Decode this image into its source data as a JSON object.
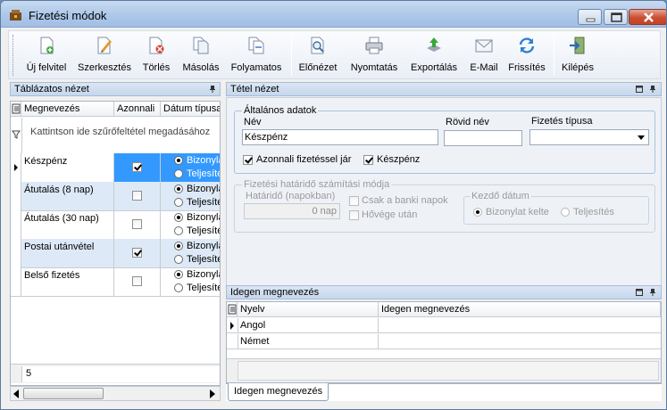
{
  "window": {
    "title": "Fizetési módok"
  },
  "toolbar": {
    "items": [
      {
        "label": "Új felvitel",
        "icon": "new-document-icon"
      },
      {
        "label": "Szerkesztés",
        "icon": "edit-icon"
      },
      {
        "label": "Törlés",
        "icon": "delete-icon"
      },
      {
        "label": "Másolás",
        "icon": "copy-icon"
      },
      {
        "label": "Folyamatos",
        "icon": "continuous-icon"
      },
      {
        "label": "Előnézet",
        "icon": "preview-icon"
      },
      {
        "label": "Nyomtatás",
        "icon": "printer-icon"
      },
      {
        "label": "Exportálás",
        "icon": "export-icon"
      },
      {
        "label": "E-Mail",
        "icon": "mail-icon"
      },
      {
        "label": "Frissítés",
        "icon": "refresh-icon"
      },
      {
        "label": "Kilépés",
        "icon": "exit-icon"
      }
    ]
  },
  "left_panel": {
    "title": "Táblázatos nézet",
    "columns": [
      "Megnevezés",
      "Azonnali",
      "Dátum típusa"
    ],
    "filter_hint": "Kattintson ide szűrőfeltétel megadásához",
    "date_options": [
      "Bizonylat kelte",
      "Teljesítés"
    ],
    "rows": [
      {
        "name": "Készpénz",
        "azonnali": true,
        "selected": "Bizonylat kelte"
      },
      {
        "name": "Átutalás (8 nap)",
        "azonnali": false,
        "selected": "Bizonylat kelte"
      },
      {
        "name": "Átutalás (30 nap)",
        "azonnali": false,
        "selected": "Bizonylat kelte"
      },
      {
        "name": "Postai utánvétel",
        "azonnali": true,
        "selected": "Bizonylat kelte"
      },
      {
        "name": "Belső fizetés",
        "azonnali": false,
        "selected": "Bizonylat kelte"
      }
    ],
    "count": "5"
  },
  "detail": {
    "title": "Tétel nézet",
    "general_group": "Általános adatok",
    "name_label": "Név",
    "name_value": "Készpénz",
    "short_label": "Rövid név",
    "short_value": "",
    "type_label": "Fizetés típusa",
    "type_value": "",
    "immediate_label": "Azonnali fizetéssel jár",
    "cash_label": "Készpénz",
    "deadline_group": "Fizetési határidő számítási módja",
    "deadline_label": "Határidő (napokban)",
    "deadline_value": "0 nap",
    "bank_days_label": "Csak a banki napok",
    "after_weekend_label": "Hővége után",
    "start_date_group": "Kezdő dátum",
    "start_date_opt1": "Bizonylat kelte",
    "start_date_opt2": "Teljesítés"
  },
  "foreign": {
    "title": "Idegen megnevezés",
    "columns": [
      "Nyelv",
      "Idegen megnevezés"
    ],
    "rows": [
      {
        "lang": "Angol",
        "name": ""
      },
      {
        "lang": "Német",
        "name": ""
      }
    ],
    "tab_label": "Idegen megnevezés"
  }
}
